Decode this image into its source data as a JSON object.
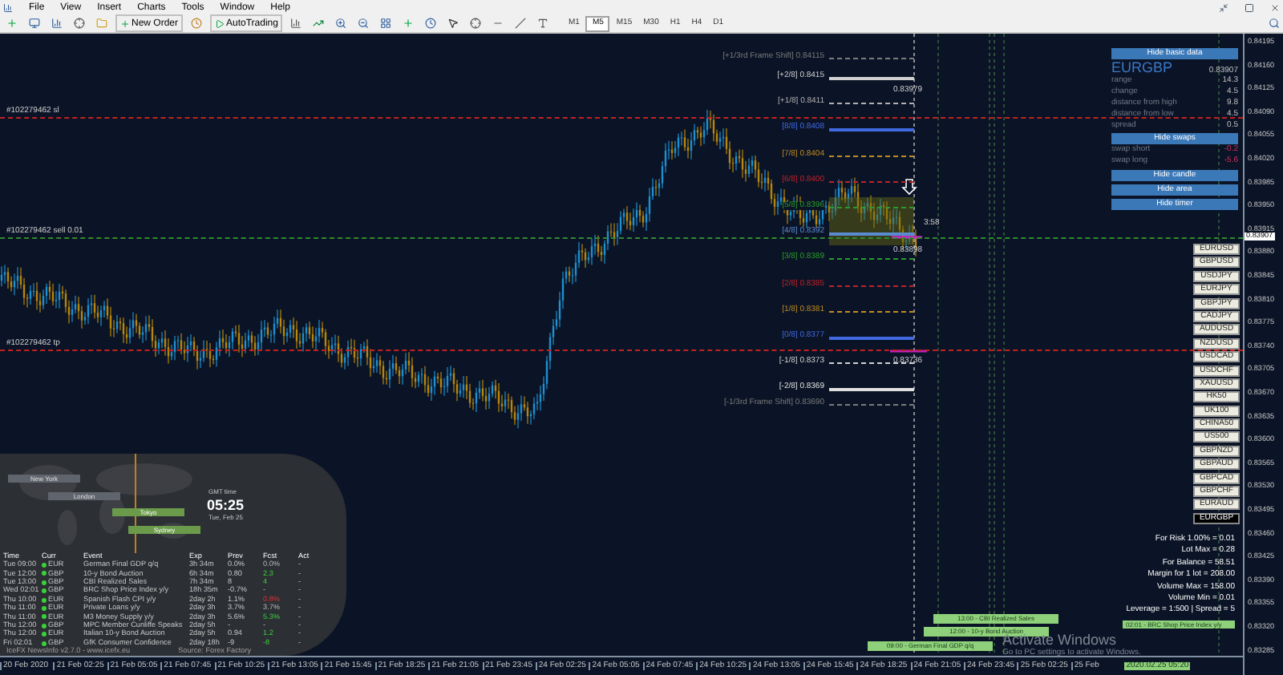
{
  "menu": [
    "File",
    "View",
    "Insert",
    "Charts",
    "Tools",
    "Window",
    "Help"
  ],
  "toolbar": {
    "new_order": "New Order",
    "auto_trading": "AutoTrading",
    "timeframes": [
      {
        "label": "M1",
        "selected": false
      },
      {
        "label": "M5",
        "selected": true
      },
      {
        "label": "M15",
        "selected": false
      },
      {
        "label": "M30",
        "selected": false
      },
      {
        "label": "H1",
        "selected": false
      },
      {
        "label": "H4",
        "selected": false
      },
      {
        "label": "D1",
        "selected": false
      }
    ]
  },
  "chart": {
    "price_axis": [
      "0.84195",
      "0.84160",
      "0.84125",
      "0.84090",
      "0.84055",
      "0.84020",
      "0.83985",
      "0.83950",
      "0.83915",
      "0.83880",
      "0.83845",
      "0.83810",
      "0.83775",
      "0.83740",
      "0.83705",
      "0.83670",
      "0.83635",
      "0.83600",
      "0.83565",
      "0.83530",
      "0.83495",
      "0.83460",
      "0.83425",
      "0.83390",
      "0.83355",
      "0.83320",
      "0.83285"
    ],
    "current_price": "0.83907",
    "time_axis": [
      "20 Feb 2020",
      "21 Feb 02:25",
      "21 Feb 05:05",
      "21 Feb 07:45",
      "21 Feb 10:25",
      "21 Feb 13:05",
      "21 Feb 15:45",
      "21 Feb 18:25",
      "21 Feb 21:05",
      "21 Feb 23:45",
      "24 Feb 02:25",
      "24 Feb 05:05",
      "24 Feb 07:45",
      "24 Feb 10:25",
      "24 Feb 13:05",
      "24 Feb 15:45",
      "24 Feb 18:25",
      "24 Feb 21:05",
      "24 Feb 23:45",
      "25 Feb 02:25",
      "25 Feb"
    ],
    "time_marker": "2020.02.25 05:20",
    "order_lines": [
      {
        "label": "#102279462 sl",
        "kind": "sl"
      },
      {
        "label": "#102279462 sell 0.01",
        "kind": "entry"
      },
      {
        "label": "#102279462 tp",
        "kind": "tp"
      }
    ],
    "murrey_levels": [
      {
        "label": "[+1/3rd Frame Shift]",
        "price": "0.84115",
        "color": "#7a7a7a",
        "dashed": true
      },
      {
        "label": "[+2/8]",
        "price": "0.8415",
        "color": "#d0d0d0",
        "dashed": false
      },
      {
        "label": "[+1/8]",
        "price": "0.8411",
        "color": "#b0b0b0",
        "dashed": true
      },
      {
        "label": "[8/8]",
        "price": "0.8408",
        "color": "#4169e1",
        "dashed": false
      },
      {
        "label": "[7/8]",
        "price": "0.8404",
        "color": "#c08a20",
        "dashed": true
      },
      {
        "label": "[6/8]",
        "price": "0.8400",
        "color": "#c0202a",
        "dashed": true
      },
      {
        "label": "[5/8]",
        "price": "0.8396",
        "color": "#2a9a2a",
        "dashed": true
      },
      {
        "label": "[4/8]",
        "price": "0.8392",
        "color": "#5a8ad0",
        "dashed": false
      },
      {
        "label": "[3/8]",
        "price": "0.8389",
        "color": "#2a9a2a",
        "dashed": true
      },
      {
        "label": "[2/8]",
        "price": "0.8385",
        "color": "#c0202a",
        "dashed": true
      },
      {
        "label": "[1/8]",
        "price": "0.8381",
        "color": "#c08a20",
        "dashed": true
      },
      {
        "label": "[0/8]",
        "price": "0.8377",
        "color": "#4169e1",
        "dashed": false
      },
      {
        "label": "[-1/8]",
        "price": "0.8373",
        "color": "#d0d0d0",
        "dashed": true
      },
      {
        "label": "[-2/8]",
        "price": "0.8369",
        "color": "#e0e0e0",
        "dashed": false
      },
      {
        "label": "[-1/3rd Frame Shift]",
        "price": "0.83690",
        "color": "#7a7a7a",
        "dashed": true
      }
    ],
    "price_tags": [
      "0.83979",
      "0.83898",
      "0.83736"
    ],
    "timer": "3:58"
  },
  "info_panel": {
    "hide_basic": "Hide basic data",
    "symbol": "EURGBP",
    "price": "0.83907",
    "rows": [
      {
        "label": "range",
        "value": "14.3",
        "negative": false
      },
      {
        "label": "change",
        "value": "4.5",
        "negative": false
      },
      {
        "label": "distance from high",
        "value": "9.8",
        "negative": false
      },
      {
        "label": "distance from low",
        "value": "4.5",
        "negative": false
      },
      {
        "label": "spread",
        "value": "0.5",
        "negative": false
      }
    ],
    "hide_swaps": "Hide swaps",
    "swaps": [
      {
        "label": "swap short",
        "value": "-0.2",
        "negative": true
      },
      {
        "label": "swap long",
        "value": "-5.6",
        "negative": true
      }
    ],
    "buttons": [
      "Hide candle",
      "Hide area",
      "Hide timer"
    ]
  },
  "symbols": [
    {
      "label": "EURUSD",
      "selected": false
    },
    {
      "label": "GBPUSD",
      "selected": false
    },
    {
      "label": "USDJPY",
      "selected": false
    },
    {
      "label": "EURJPY",
      "selected": false
    },
    {
      "label": "GBPJPY",
      "selected": false
    },
    {
      "label": "CADJPY",
      "selected": false
    },
    {
      "label": "AUDUSD",
      "selected": false
    },
    {
      "label": "NZDUSD",
      "selected": false
    },
    {
      "label": "USDCAD",
      "selected": false
    },
    {
      "label": "USDCHF",
      "selected": false
    },
    {
      "label": "XAUUSD",
      "selected": false
    },
    {
      "label": "HK50",
      "selected": false
    },
    {
      "label": "UK100",
      "selected": false
    },
    {
      "label": "CHINA50",
      "selected": false
    },
    {
      "label": "US500",
      "selected": false
    },
    {
      "label": "GBPNZD",
      "selected": false
    },
    {
      "label": "GBPAUD",
      "selected": false
    },
    {
      "label": "GBPCAD",
      "selected": false
    },
    {
      "label": "GBPCHF",
      "selected": false
    },
    {
      "label": "EURAUD",
      "selected": false
    },
    {
      "label": "EURGBP",
      "selected": true
    }
  ],
  "risk_info": [
    "For Risk 1.00% = 0.01",
    "Lot Max = 0.28",
    "For Balance = 58.51",
    "Margin for 1 lot = 208.00",
    "Volume Max = 158.00",
    "Volume Min = 0.01",
    "Leverage = 1:500 | Spread = 5"
  ],
  "news_bars": [
    "02:01 - BRC Shop Price Index y/y",
    "13:00 - CBI Realized Sales",
    "12:00 - 10-y Bond Auction",
    "09:00 - German Final GDP q/q"
  ],
  "os_notice": {
    "title": "Activate Windows",
    "text": "Go to PC settings to activate Windows."
  },
  "news_widget": {
    "sessions": [
      {
        "label": "New York",
        "open": false
      },
      {
        "label": "London",
        "open": false
      },
      {
        "label": "Tokyo",
        "open": true
      },
      {
        "label": "Sydney",
        "open": true
      }
    ],
    "clock_label": "GMT time",
    "clock": "05:25",
    "date": "Tue, Feb 25",
    "columns": [
      "Time",
      "Curr",
      "Event",
      "Exp",
      "Prev",
      "Fcst",
      "Act"
    ],
    "rows": [
      {
        "time": "Tue 09:00",
        "curr": "EUR",
        "event": "German Final GDP q/q",
        "exp": "3h 34m",
        "prev": "0.0%",
        "fcst": "0.0%",
        "act": "-",
        "fcst_up": false,
        "fcst_down": false
      },
      {
        "time": "Tue 12:00",
        "curr": "GBP",
        "event": "10-y Bond Auction",
        "exp": "6h 34m",
        "prev": "0.80",
        "fcst": "2.3",
        "act": "-",
        "fcst_up": true,
        "fcst_down": false
      },
      {
        "time": "Tue 13:00",
        "curr": "GBP",
        "event": "CBI Realized Sales",
        "exp": "7h 34m",
        "prev": "8",
        "fcst": "4",
        "act": "-",
        "fcst_up": true,
        "fcst_down": false
      },
      {
        "time": "Wed 02:01",
        "curr": "GBP",
        "event": "BRC Shop Price Index y/y",
        "exp": "18h 35m",
        "prev": "-0.7%",
        "fcst": "-",
        "act": "-",
        "fcst_up": false,
        "fcst_down": false
      },
      {
        "time": "Thu 10:00",
        "curr": "EUR",
        "event": "Spanish Flash CPI y/y",
        "exp": "2day 2h",
        "prev": "1.1%",
        "fcst": "0.8%",
        "act": "-",
        "fcst_up": false,
        "fcst_down": true
      },
      {
        "time": "Thu 11:00",
        "curr": "EUR",
        "event": "Private Loans y/y",
        "exp": "2day 3h",
        "prev": "3.7%",
        "fcst": "3.7%",
        "act": "-",
        "fcst_up": false,
        "fcst_down": false
      },
      {
        "time": "Thu 11:00",
        "curr": "EUR",
        "event": "M3 Money Supply y/y",
        "exp": "2day 3h",
        "prev": "5.6%",
        "fcst": "5.3%",
        "act": "-",
        "fcst_up": true,
        "fcst_down": false
      },
      {
        "time": "Thu 12:00",
        "curr": "GBP",
        "event": "MPC Member Cunliffe Speaks",
        "exp": "2day 5h",
        "prev": "-",
        "fcst": "-",
        "act": "-",
        "fcst_up": false,
        "fcst_down": false
      },
      {
        "time": "Thu 12:00",
        "curr": "EUR",
        "event": "Italian 10-y Bond Auction",
        "exp": "2day 5h",
        "prev": "0.94",
        "fcst": "1.2",
        "act": "-",
        "fcst_up": true,
        "fcst_down": false
      },
      {
        "time": "Fri 02:01",
        "curr": "GBP",
        "event": "GfK Consumer Confidence",
        "exp": "2day 18h",
        "prev": "-9",
        "fcst": "-8",
        "act": "-",
        "fcst_up": true,
        "fcst_down": false
      }
    ],
    "footer": "IceFX NewsInfo v2.7.0 - www.icefx.eu",
    "source": "Source: Forex Factory"
  }
}
